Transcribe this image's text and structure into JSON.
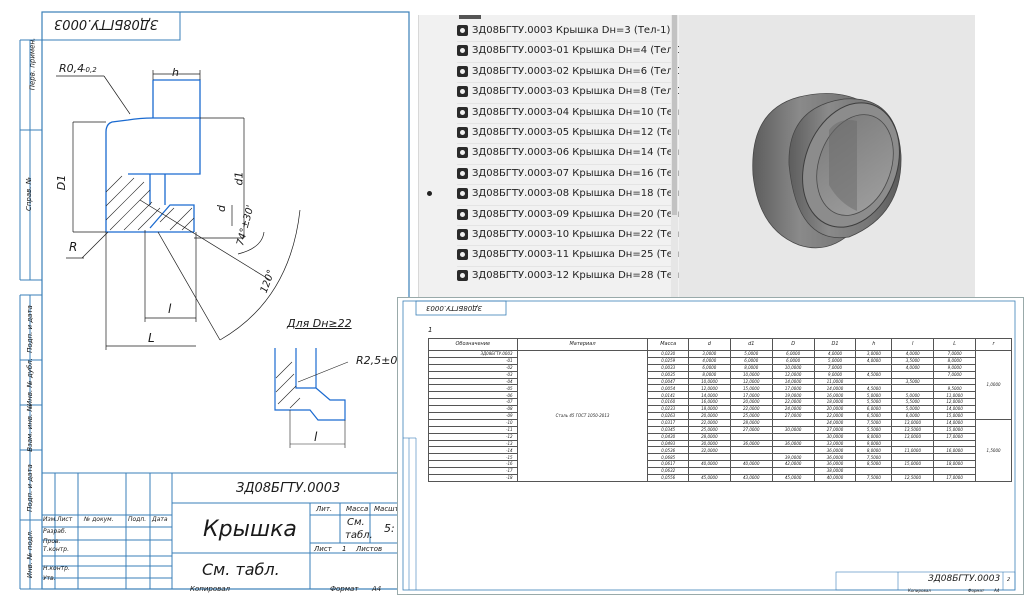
{
  "drawing": {
    "code_rotated": "ЗД08БГТУ.0003",
    "left_margin_labels": [
      "Перв. примен.",
      "Справ. №",
      "Подп. и дата",
      "Инв. № дубл.",
      "Взам. инв. №",
      "Подп. и дата",
      "Инв. № подл."
    ],
    "dims": {
      "radius_label": "R0,4",
      "radius_tol": "-0,2",
      "h": "h",
      "D1": "D1",
      "d1": "d1",
      "d": "d",
      "R": "R",
      "angle_small": "74°±30'",
      "angle_large": "120°",
      "l_inner": "l",
      "L": "L",
      "detail_title": "Для Dн≥22",
      "detail_radius": "R2,5±0,5",
      "detail_l": "l"
    },
    "title_block": {
      "designation": "ЗД08БГТУ.0003",
      "name": "Крышка",
      "material": "См. табл.",
      "lit_header": "Лит.",
      "mass_header": "Масса",
      "scale_header": "Масшт.",
      "mass_value_1": "См.",
      "mass_value_2": "табл.",
      "scale_value": "5:",
      "sheet_label": "Лист",
      "sheet_value": "1",
      "sheets_label": "Листов",
      "rows": [
        "Изм.",
        "Лист",
        "№ докум.",
        "Подп.",
        "Дата"
      ],
      "roles": [
        "Разраб.",
        "Пров.",
        "Т.контр.",
        "Н.контр.",
        "Утв."
      ],
      "copied": "Копировал",
      "format_label": "Формат",
      "format_value": "А4"
    }
  },
  "variant_list": {
    "items": [
      {
        "label": "ЗД08БГТУ.0003 Крышка Dн=3 (Тел-1)",
        "selected": false
      },
      {
        "label": "ЗД08БГТУ.0003-01 Крышка Dн=4 (Тел-1)",
        "selected": false
      },
      {
        "label": "ЗД08БГТУ.0003-02 Крышка Dн=6 (Тел-1)",
        "selected": false
      },
      {
        "label": "ЗД08БГТУ.0003-03 Крышка Dн=8 (Тел-1)",
        "selected": false
      },
      {
        "label": "ЗД08БГТУ.0003-04 Крышка Dн=10 (Тел-1)",
        "selected": false
      },
      {
        "label": "ЗД08БГТУ.0003-05 Крышка Dн=12 (Тел-1)",
        "selected": false
      },
      {
        "label": "ЗД08БГТУ.0003-06 Крышка Dн=14 (Тел-1)",
        "selected": false
      },
      {
        "label": "ЗД08БГТУ.0003-07 Крышка Dн=16 (Тел-1)",
        "selected": false
      },
      {
        "label": "ЗД08БГТУ.0003-08 Крышка Dн=18 (Тел-1)",
        "selected": true
      },
      {
        "label": "ЗД08БГТУ.0003-09 Крышка Dн=20 (Тел-1)",
        "selected": false
      },
      {
        "label": "ЗД08БГТУ.0003-10 Крышка Dн=22 (Тел-1)",
        "selected": false
      },
      {
        "label": "ЗД08БГТУ.0003-11 Крышка Dн=25 (Тел-1)",
        "selected": false
      },
      {
        "label": "ЗД08БГТУ.0003-12 Крышка Dн=28 (Тел-1)",
        "selected": false
      }
    ],
    "item_icon": "part-body-icon"
  },
  "table_sheet": {
    "code_rotated": "ЗД08БГТУ.0003",
    "sheet_number": "1",
    "footer_designation": "ЗД08БГТУ.0003",
    "footer_sheet": "2",
    "footer_copied": "Копировал",
    "footer_format": "Формат",
    "footer_format_value": "А4",
    "headers": [
      "Обозначение",
      "Материал",
      "Масса",
      "d",
      "d1",
      "D",
      "D1",
      "h",
      "l",
      "L",
      "r"
    ],
    "material": "Сталь 45 ГОСТ 1050-2013",
    "rows": [
      [
        "ЗД08БГТУ.0003",
        "0,0230",
        "3,0000",
        "5,0000",
        "6,0000",
        "4,0000",
        "3,0000",
        "4,0000",
        "7,0000"
      ],
      [
        "-01",
        "0,0259",
        "4,0000",
        "6,0000",
        "6,0000",
        "5,0000",
        "4,0000",
        "3,5000",
        "8,0000"
      ],
      [
        "-02",
        "0,0033",
        "6,0000",
        "8,0000",
        "10,0000",
        "7,0000",
        "",
        "4,0000",
        "9,0000"
      ],
      [
        "-03",
        "0,0035",
        "8,0000",
        "10,0000",
        "12,0000",
        "9,0000",
        "4,5000",
        "",
        "7,0000"
      ],
      [
        "-04",
        "0,0047",
        "10,0000",
        "12,0000",
        "14,0000",
        "11,0000",
        "",
        "3,5000",
        ""
      ],
      [
        "-05",
        "0,0054",
        "12,0000",
        "15,0000",
        "17,0000",
        "14,0000",
        "4,5000",
        "",
        "9,5000"
      ],
      [
        "-06",
        "0,0141",
        "14,0000",
        "17,0000",
        "19,0000",
        "16,0000",
        "5,0000",
        "5,0000",
        "11,0000"
      ],
      [
        "-07",
        "0,0160",
        "16,0000",
        "20,0000",
        "22,0000",
        "18,0000",
        "5,5000",
        "5,5000",
        "12,0000"
      ],
      [
        "-08",
        "0,0233",
        "18,0000",
        "22,0000",
        "24,0000",
        "20,0000",
        "6,0000",
        "5,0000",
        "14,0000"
      ],
      [
        "-09",
        "0,0263",
        "20,0000",
        "25,0000",
        "27,0000",
        "22,0000",
        "6,5000",
        "6,0000",
        "15,0000"
      ],
      [
        "-10",
        "0,0317",
        "22,0000",
        "28,0000",
        "",
        "24,0000",
        "7,5000",
        "13,0000",
        "14,0000"
      ],
      [
        "-11",
        "0,0345",
        "25,0000",
        "27,0000",
        "30,0000",
        "27,0000",
        "5,5000",
        "13,5000",
        "15,0000"
      ],
      [
        "-12",
        "0,0430",
        "28,0000",
        "",
        "",
        "30,0000",
        "8,0000",
        "13,0000",
        "17,0000"
      ],
      [
        "-13",
        "0,0493",
        "30,0000",
        "36,0000",
        "36,0000",
        "33,0000",
        "9,0000",
        "",
        ""
      ],
      [
        "-14",
        "0,0536",
        "32,0000",
        "",
        "",
        "36,0000",
        "8,0000",
        "11,0000",
        "16,0000"
      ],
      [
        "-15",
        "0,0685",
        "",
        "",
        "39,0000",
        "36,0000",
        "7,5000",
        "",
        ""
      ],
      [
        "-16",
        "0,0617",
        "40,0000",
        "40,0000",
        "42,0000",
        "36,0000",
        "8,5000",
        "15,0000",
        "18,0000"
      ],
      [
        "-17",
        "0,0632",
        "",
        "",
        "",
        "38,0000",
        "",
        "",
        ""
      ],
      [
        "-18",
        "0,0556",
        "45,0000",
        "43,0000",
        "45,0000",
        "40,0000",
        "7,5000",
        "12,5000",
        "17,0000"
      ]
    ],
    "r_values": [
      "1,0000",
      "1,5000"
    ]
  },
  "colors": {
    "sheet_frame": "#3a7fb8",
    "list_bg": "#f1f1f1",
    "viewport_bg": "#e7e7e7",
    "part_gray": "#6b6b6b"
  }
}
